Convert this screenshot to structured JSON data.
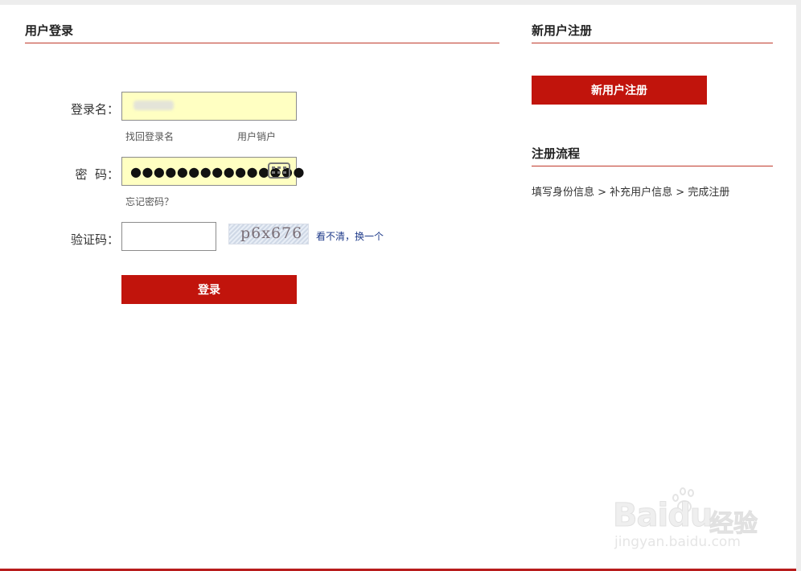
{
  "login": {
    "title": "用户登录",
    "username_label": "登录名：",
    "find_username_link": "找回登录名",
    "cancel_user_link": "用户销户",
    "password_label": "密  码：",
    "password_masked": "●●●●●●●●●●●●●●●",
    "forgot_password_link": "忘记密码？",
    "captcha_label": "验证码：",
    "captcha_code": "p6x676",
    "captcha_refresh_link": "看不清，换一个",
    "submit_label": "登录",
    "field_bg_color": "#ffffc2"
  },
  "register": {
    "title": "新用户注册",
    "button_label": "新用户注册",
    "flow_title": "注册流程",
    "flow_steps": "填写身份信息 > 补充用户信息 > 完成注册"
  },
  "watermark": {
    "brand": "Baidu",
    "brand_cn": "经验",
    "url": "jingyan.baidu.com"
  },
  "colors": {
    "accent": "#c1140c",
    "rule": "#c0392b",
    "link": "#1f3b8a"
  }
}
